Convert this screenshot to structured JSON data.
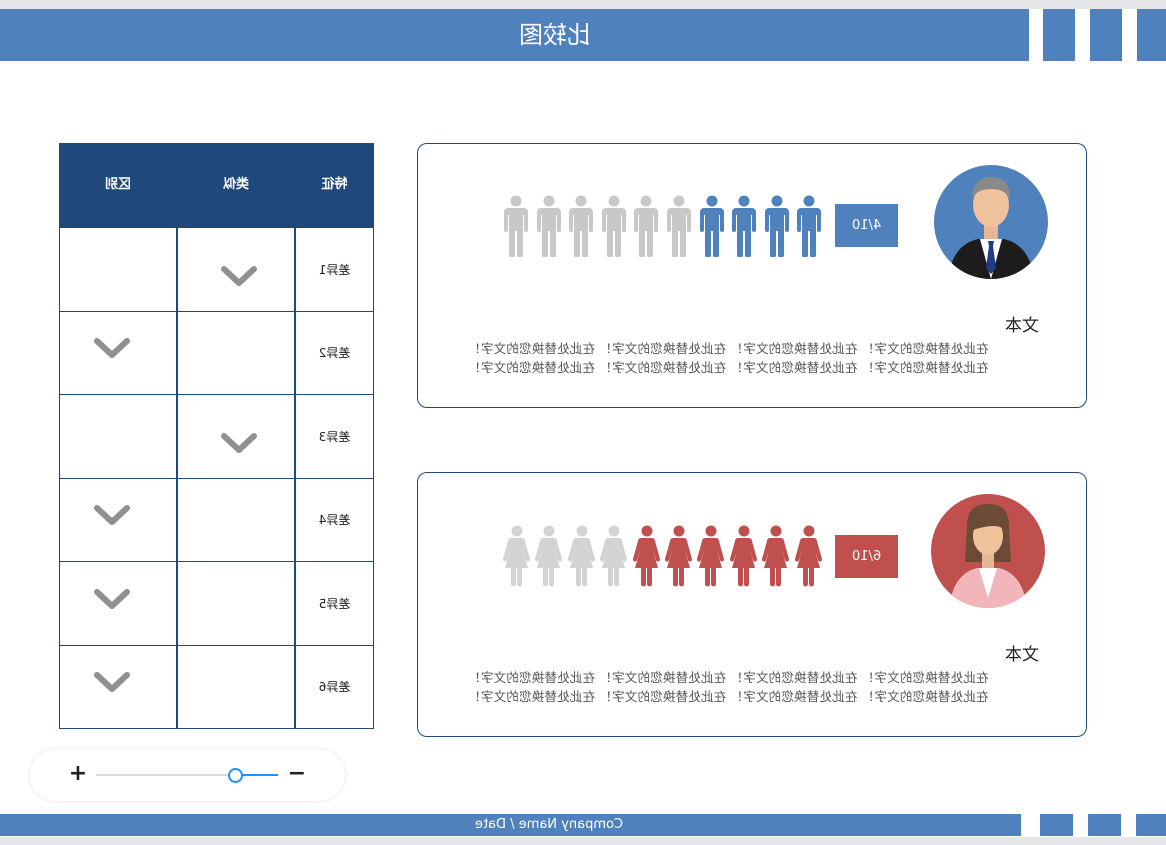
{
  "header": {
    "title": "比较图"
  },
  "footer": {
    "text": "Company Name / Date"
  },
  "table": {
    "headers": [
      "特征",
      "类似",
      "区别"
    ],
    "rows": [
      {
        "label": "差异1",
        "similar": true,
        "different": false
      },
      {
        "label": "差异2",
        "similar": false,
        "different": true
      },
      {
        "label": "差异3",
        "similar": true,
        "different": false
      },
      {
        "label": "差异4",
        "similar": false,
        "different": true
      },
      {
        "label": "差异5",
        "similar": false,
        "different": true
      },
      {
        "label": "差异6",
        "similar": false,
        "different": true
      }
    ]
  },
  "cards": [
    {
      "ratio": "4/10",
      "filled": 4,
      "total": 10,
      "figure": "male-figure-icon",
      "accent": "#4f81bd",
      "muted": "#c8c8c8",
      "avatar": "businessman-avatar-icon",
      "heading": "文本",
      "lines": [
        "在此处替换您的文字！ 在此处替换您的文字！ 在此处替换您的文字！ 在此处替换您的文字！",
        "在此处替换您的文字！ 在此处替换您的文字！ 在此处替换您的文字！ 在此处替换您的文字！"
      ]
    },
    {
      "ratio": "6/10",
      "filled": 6,
      "total": 10,
      "figure": "female-figure-icon",
      "accent": "#c0504d",
      "muted": "#d3d3d3",
      "avatar": "businesswoman-avatar-icon",
      "heading": "文本",
      "lines": [
        "在此处替换您的文字！ 在此处替换您的文字！ 在此处替换您的文字！ 在此处替换您的文字！",
        "在此处替换您的文字！ 在此处替换您的文字！ 在此处替换您的文字！ 在此处替换您的文字！"
      ]
    }
  ],
  "zoom": {
    "plus_label": "+",
    "minus_label": "−",
    "level": 0.77
  }
}
